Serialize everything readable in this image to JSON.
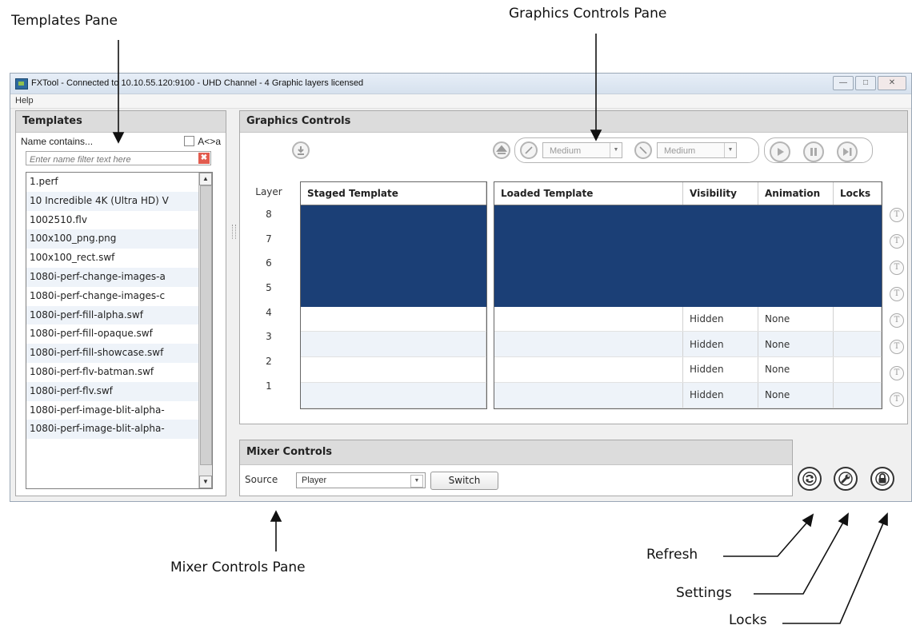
{
  "callouts": {
    "templates_pane": "Templates Pane",
    "graphics_controls_pane": "Graphics Controls Pane",
    "mixer_controls_pane": "Mixer Controls Pane",
    "refresh": "Refresh",
    "settings": "Settings",
    "locks": "Locks"
  },
  "window": {
    "title": "FXTool - Connected to 10.10.55.120:9100 - UHD Channel - 4 Graphic layers licensed",
    "menu": [
      "Help"
    ]
  },
  "templates": {
    "title": "Templates",
    "name_contains": "Name contains...",
    "case_toggle": "A<>a",
    "filter_placeholder": "Enter name filter text here",
    "items": [
      "1.perf",
      "10 Incredible 4K (Ultra HD) V",
      "1002510.flv",
      "100x100_png.png",
      "100x100_rect.swf",
      "1080i-perf-change-images-a",
      "1080i-perf-change-images-c",
      "1080i-perf-fill-alpha.swf",
      "1080i-perf-fill-opaque.swf",
      "1080i-perf-fill-showcase.swf",
      "1080i-perf-flv-batman.swf",
      "1080i-perf-flv.swf",
      "1080i-perf-image-blit-alpha-",
      "1080i-perf-image-blit-alpha-"
    ]
  },
  "graphics": {
    "title": "Graphics Controls",
    "speed_in": "Medium",
    "speed_out": "Medium",
    "layer_header": "Layer",
    "staged_header": "Staged Template",
    "loaded_header": "Loaded Template",
    "visibility_header": "Visibility",
    "animation_header": "Animation",
    "locks_header": "Locks",
    "rows": [
      {
        "layer": "8",
        "visibility": "",
        "animation": ""
      },
      {
        "layer": "7",
        "visibility": "",
        "animation": ""
      },
      {
        "layer": "6",
        "visibility": "",
        "animation": ""
      },
      {
        "layer": "5",
        "visibility": "",
        "animation": ""
      },
      {
        "layer": "4",
        "visibility": "Hidden",
        "animation": "None"
      },
      {
        "layer": "3",
        "visibility": "Hidden",
        "animation": "None"
      },
      {
        "layer": "2",
        "visibility": "Hidden",
        "animation": "None"
      },
      {
        "layer": "1",
        "visibility": "Hidden",
        "animation": "None"
      }
    ],
    "accent_color": "#1b3f76"
  },
  "mixer": {
    "title": "Mixer Controls",
    "source_label": "Source",
    "source_value": "Player",
    "switch_label": "Switch"
  }
}
